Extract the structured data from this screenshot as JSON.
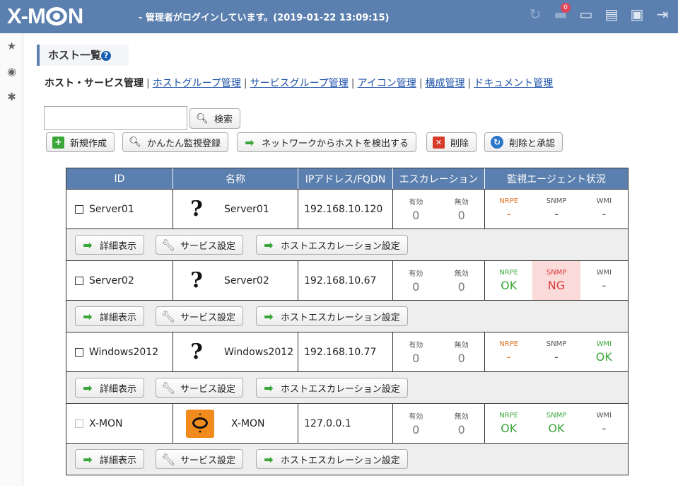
{
  "header": {
    "logo": "X-MON",
    "status": "- 管理者がログインしています。(2019-01-22 13:09:15)",
    "icons": [
      "refresh-icon",
      "notification-icon",
      "screen-share-icon",
      "server-icon",
      "info-icon",
      "logout-icon"
    ],
    "notification_count": "0"
  },
  "sidebar": {
    "icons": [
      "star-icon",
      "eye-icon",
      "gear-icon"
    ]
  },
  "page": {
    "title": "ホスト一覧",
    "help": "?"
  },
  "subnav": {
    "current": "ホスト・サービス管理",
    "links": [
      "ホストグループ管理",
      "サービスグループ管理",
      "アイコン管理",
      "構成管理",
      "ドキュメント管理"
    ]
  },
  "search": {
    "value": "",
    "button": "検索"
  },
  "toolbar": {
    "new": "新規作成",
    "easy": "かんたん監視登録",
    "discover": "ネットワークからホストを検出する",
    "delete": "削除",
    "delete_approve": "削除と承認"
  },
  "table": {
    "headers": {
      "id": "ID",
      "name": "名称",
      "ip": "IPアドレス/FQDN",
      "esc": "エスカレーション",
      "agent": "監視エージェント状況"
    },
    "esc_labels": {
      "enabled": "有効",
      "disabled": "無効"
    },
    "agent_labels": {
      "nrpe": "NRPE",
      "snmp": "SNMP",
      "wmi": "WMI"
    },
    "actions": {
      "detail": "詳細表示",
      "service": "サービス設定",
      "escalation": "ホストエスカレーション設定"
    },
    "rows": [
      {
        "id": "Server01",
        "name": "Server01",
        "icon": "question-icon",
        "ip": "192.168.10.120",
        "enabled": "0",
        "disabled": "0",
        "nrpe": "-",
        "snmp": "-",
        "wmi": "-"
      },
      {
        "id": "Server02",
        "name": "Server02",
        "icon": "question-icon",
        "ip": "192.168.10.67",
        "enabled": "0",
        "disabled": "0",
        "nrpe": "OK",
        "snmp": "NG",
        "wmi": "-"
      },
      {
        "id": "Windows2012",
        "name": "Windows2012",
        "icon": "question-icon",
        "ip": "192.168.10.77",
        "enabled": "0",
        "disabled": "0",
        "nrpe": "-",
        "snmp": "-",
        "wmi": "OK"
      },
      {
        "id": "X-MON",
        "name": "X-MON",
        "icon": "xmon-logo-icon",
        "ip": "127.0.0.1",
        "enabled": "0",
        "disabled": "0",
        "nrpe": "OK",
        "snmp": "OK",
        "wmi": "-"
      }
    ]
  }
}
